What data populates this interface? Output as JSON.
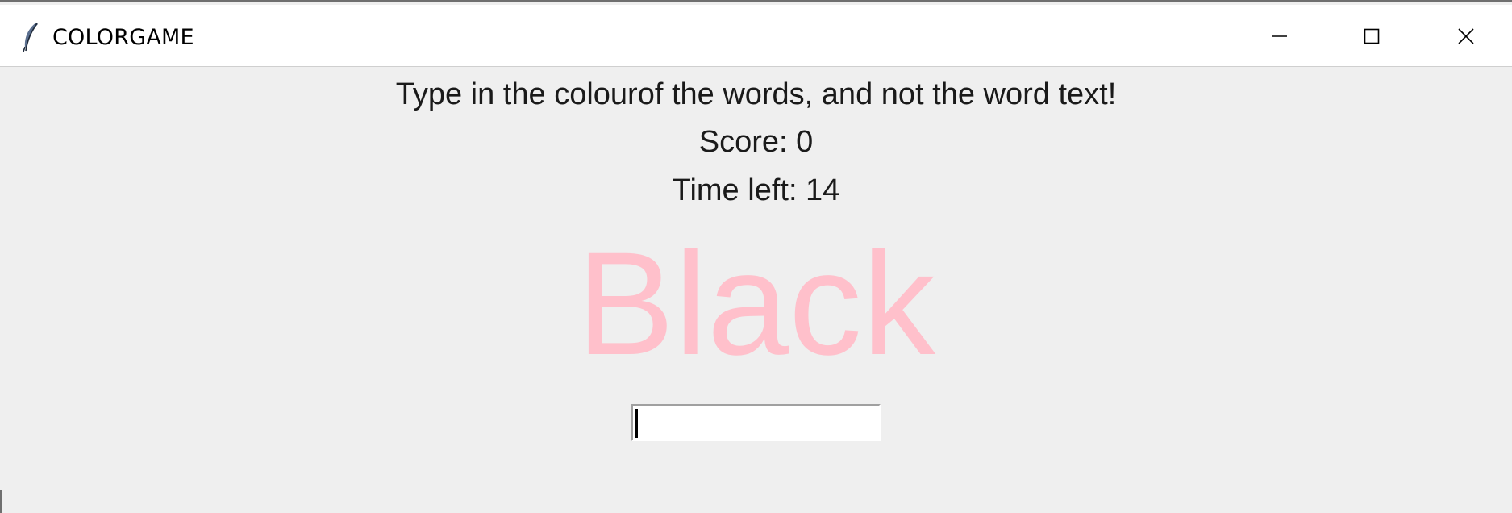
{
  "window": {
    "title": "COLORGAME",
    "icon": "feather-icon",
    "controls": {
      "minimize": "minimize-icon",
      "maximize": "maximize-icon",
      "close": "close-icon"
    }
  },
  "game": {
    "instructions": "Type in the colourof the words, and not the word text!",
    "score_text": "Score: 0",
    "time_text": "Time left: 14",
    "word": "Black",
    "word_color": "#ffc0cb",
    "text_color": "#1a1a1a"
  },
  "entry": {
    "value": "",
    "placeholder": ""
  },
  "colors": {
    "background": "#efefef",
    "titlebar": "#ffffff"
  }
}
